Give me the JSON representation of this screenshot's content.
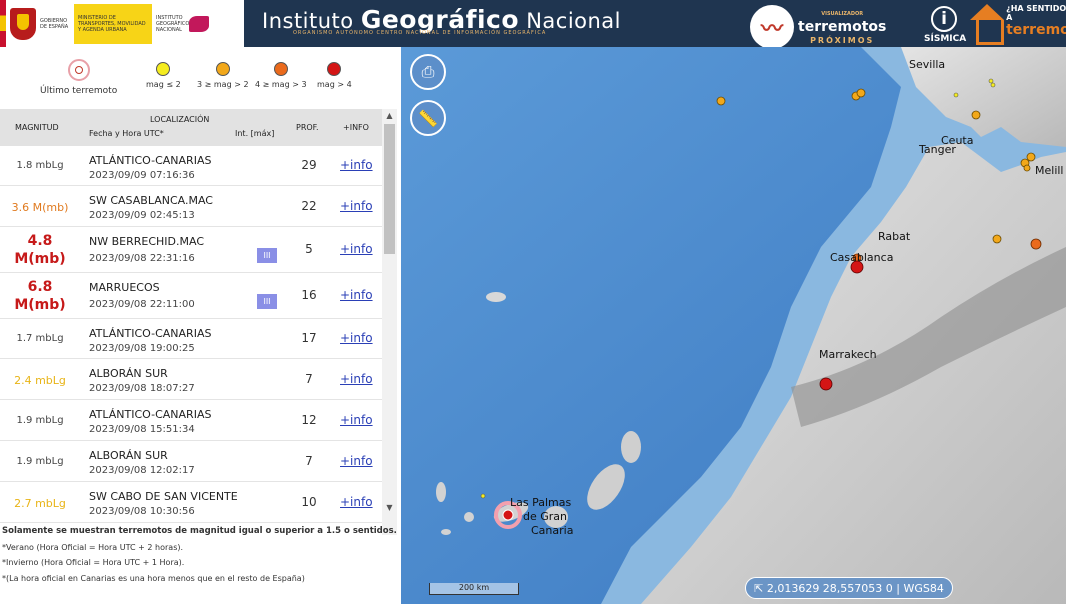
{
  "header": {
    "gov_text_1": "GOBIERNO DE ESPAÑA",
    "gov_text_2": "MINISTERIO DE TRANSPORTES, MOVILIDAD Y AGENDA URBANA",
    "gov_text_3": "INSTITUTO GEOGRÁFICO NACIONAL",
    "title_prefix": "Instituto ",
    "title_main": "Geográfico",
    "title_suffix": " Nacional",
    "subtitle": "ORGANISMO AUTÓNOMO CENTRO NACIONAL DE INFORMACIÓN GEOGRÁFICA",
    "viz_small": "VISUALIZADOR",
    "viz_main": "terremotos",
    "viz_prox": "PRÓXIMOS",
    "sismica_label": "SÍSMICA",
    "hasentido_1": "¿HA SENTIDO A",
    "hasentido_2": "terremo"
  },
  "legend": {
    "last": "Último terremoto",
    "items": [
      {
        "label": "mag ≤ 2",
        "color": "#f5ec1f"
      },
      {
        "label": "3 ≥ mag > 2",
        "color": "#f2a81a"
      },
      {
        "label": "4 ≥ mag > 3",
        "color": "#ea6a1c"
      },
      {
        "label": "mag > 4",
        "color": "#d41515"
      }
    ]
  },
  "table": {
    "col_magnitud": "MAGNITUD",
    "col_localizacion": "LOCALIZACIÓN",
    "col_fecha": "Fecha y Hora UTC*",
    "col_int": "Int. [máx]",
    "col_prof": "PROF.",
    "col_info": "+INFO",
    "rows": [
      {
        "mag": "1.8 mbLg",
        "loc": "ATLÁNTICO-CANARIAS",
        "dt": "2023/09/09 07:16:36",
        "int": "",
        "prof": "29",
        "info": "+info",
        "color": "#444"
      },
      {
        "mag": "3.6 M(mb)",
        "loc": "SW CASABLANCA.MAC",
        "dt": "2023/09/09 02:45:13",
        "int": "",
        "prof": "22",
        "info": "+info",
        "color": "#e07a1f"
      },
      {
        "mag": "4.8 M(mb)",
        "loc": "NW BERRECHID.MAC",
        "dt": "2023/09/08 22:31:16",
        "int": "III",
        "prof": "5",
        "info": "+info",
        "color": "#c61a1a"
      },
      {
        "mag": "6.8 M(mb)",
        "loc": "MARRUECOS",
        "dt": "2023/09/08 22:11:00",
        "int": "III",
        "prof": "16",
        "info": "+info",
        "color": "#c61a1a"
      },
      {
        "mag": "1.7 mbLg",
        "loc": "ATLÁNTICO-CANARIAS",
        "dt": "2023/09/08 19:00:25",
        "int": "",
        "prof": "17",
        "info": "+info",
        "color": "#444"
      },
      {
        "mag": "2.4 mbLg",
        "loc": "ALBORÁN SUR",
        "dt": "2023/09/08 18:07:27",
        "int": "",
        "prof": "7",
        "info": "+info",
        "color": "#e8b417"
      },
      {
        "mag": "1.9 mbLg",
        "loc": "ATLÁNTICO-CANARIAS",
        "dt": "2023/09/08 15:51:34",
        "int": "",
        "prof": "12",
        "info": "+info",
        "color": "#444"
      },
      {
        "mag": "1.9 mbLg",
        "loc": "ALBORÁN SUR",
        "dt": "2023/09/08 12:02:17",
        "int": "",
        "prof": "7",
        "info": "+info",
        "color": "#444"
      },
      {
        "mag": "2.7 mbLg",
        "loc": "SW CABO DE SAN VICENTE",
        "dt": "2023/09/08 10:30:56",
        "int": "",
        "prof": "10",
        "info": "+info",
        "color": "#e8b417"
      }
    ]
  },
  "notes": {
    "main": "Solamente se muestran terremotos de magnitud igual o superior a 1.5 o sentidos.",
    "summer": "*Verano (Hora Oficial = Hora UTC + 2 horas).",
    "winter": "*Invierno (Hora Oficial = Hora UTC + 1 Hora).",
    "canarias": "*(La hora oficial en Canarias es una hora menos que en el resto de España)"
  },
  "map": {
    "cities": {
      "sevilla": "Sevilla",
      "ceuta": "Ceuta",
      "tanger": "Tanger",
      "melilla": "Melill",
      "rabat": "Rabat",
      "casablanca": "Casablanca",
      "marrakech": "Marrakech",
      "laspalmas_1": "Las Palmas",
      "laspalmas_2": "de Gran",
      "laspalmas_3": "Canaria"
    },
    "scale_label": "200 km",
    "coords": "2,013629   28,557053   0 | WGS84"
  }
}
